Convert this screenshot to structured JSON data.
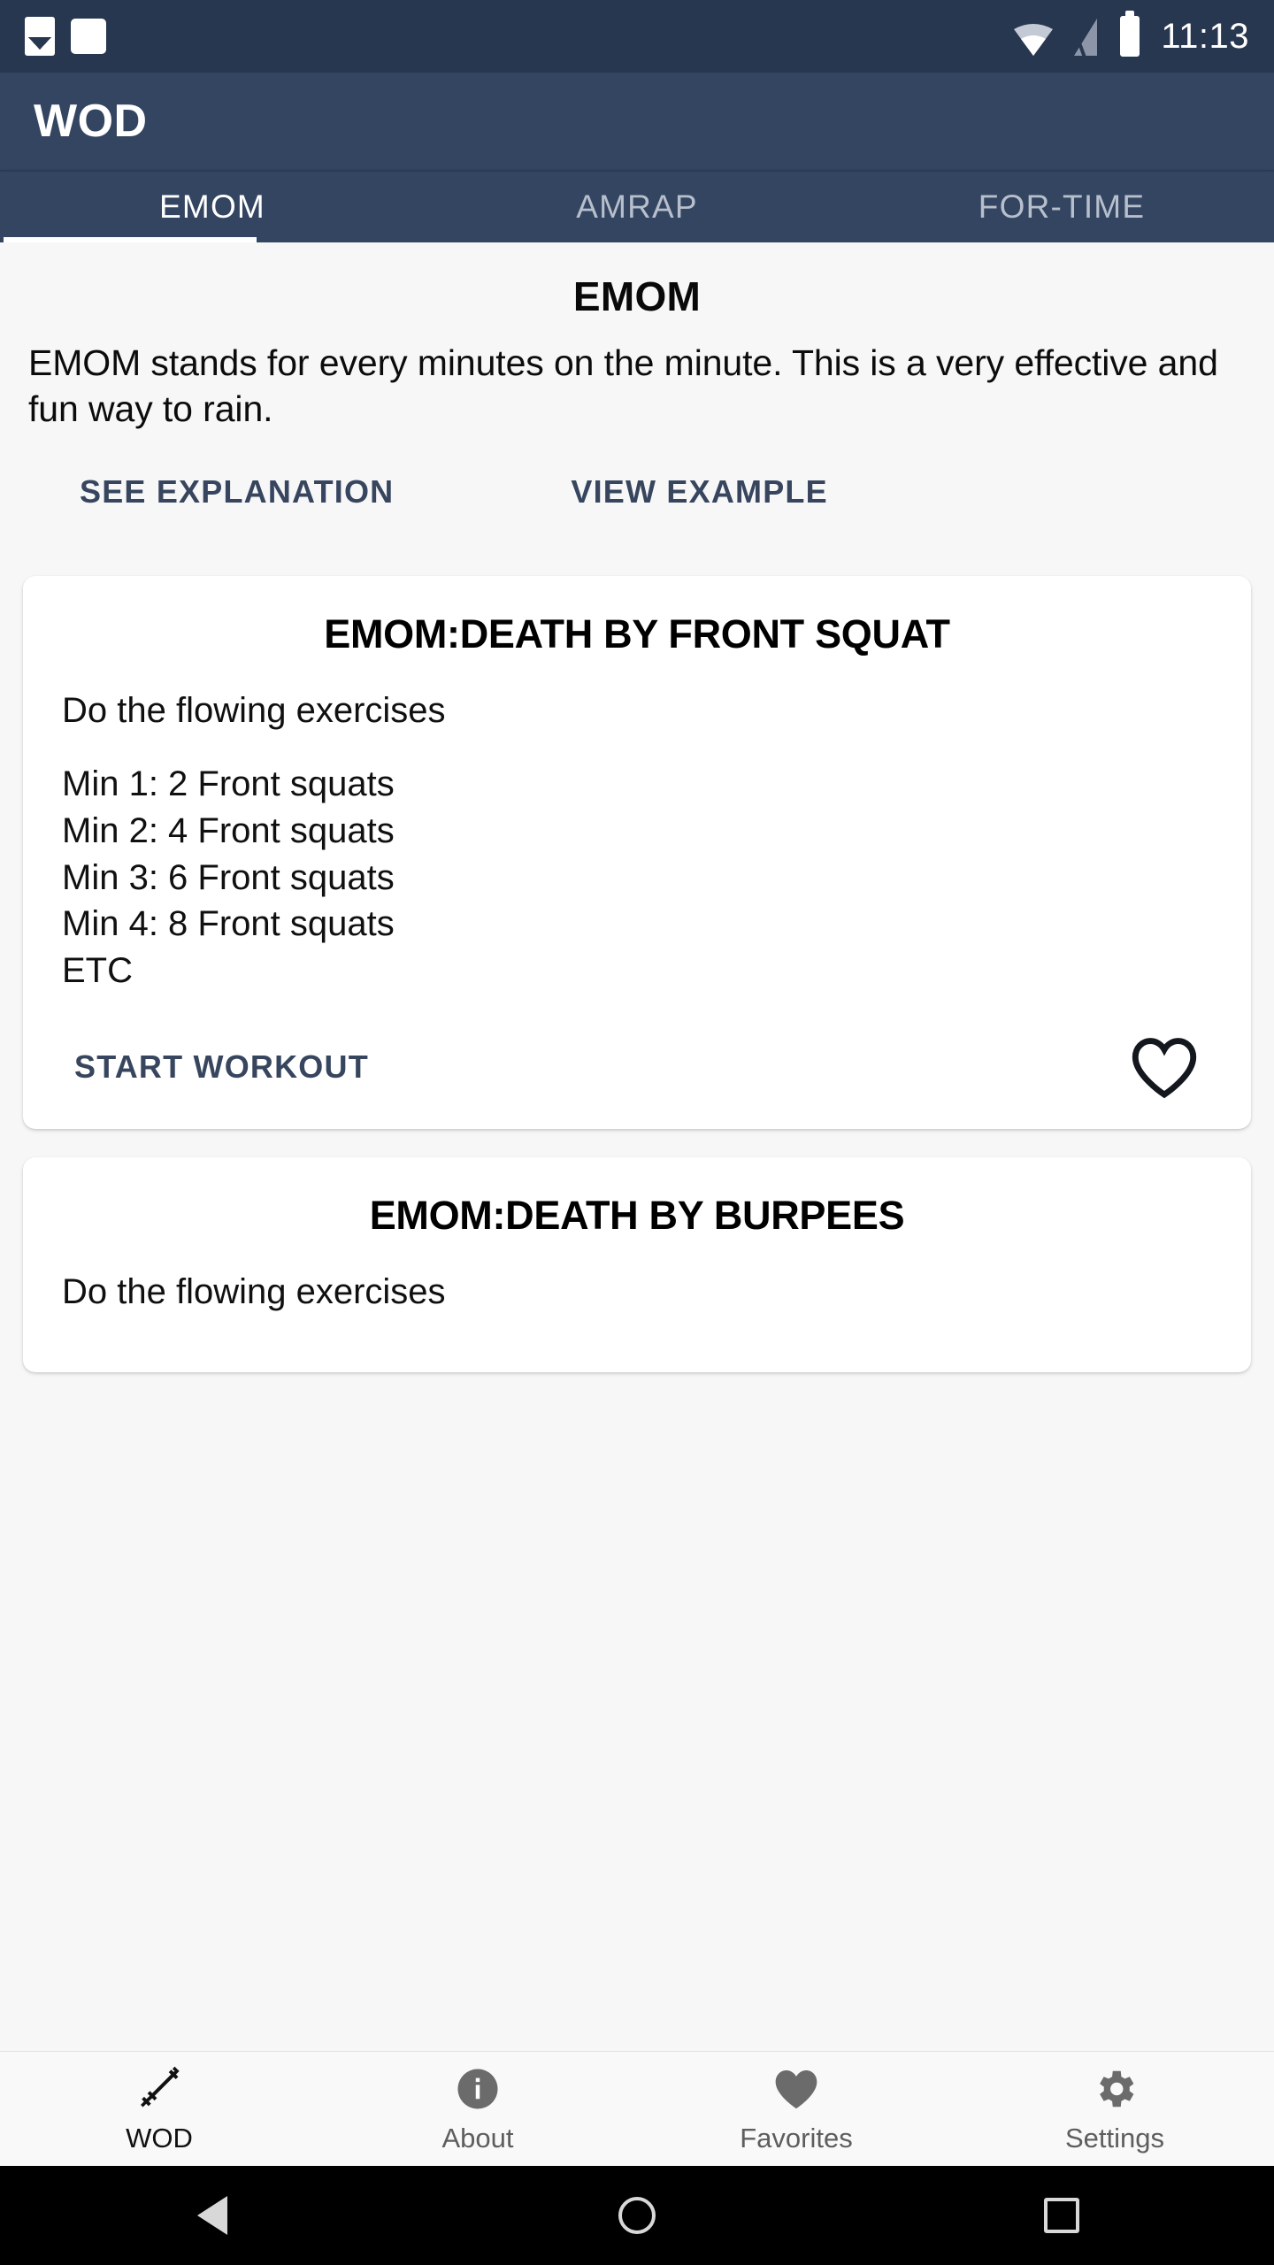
{
  "status_bar": {
    "time": "11:13",
    "icons": [
      "image-icon",
      "white-square-icon",
      "wifi-icon",
      "signal-off-icon",
      "battery-icon"
    ]
  },
  "app_bar": {
    "title": "WOD"
  },
  "tabs": [
    {
      "label": "EMOM",
      "active": true
    },
    {
      "label": "AMRAP",
      "active": false
    },
    {
      "label": "FOR-TIME",
      "active": false
    }
  ],
  "intro": {
    "title": "EMOM",
    "text": "EMOM stands for every minutes on the minute. This is a very effective and fun way to rain.",
    "see_explanation_label": "SEE EXPLANATION",
    "view_example_label": "VIEW EXAMPLE"
  },
  "cards": [
    {
      "title": "EMOM:DEATH BY FRONT SQUAT",
      "lead": "Do the flowing exercises",
      "lines": "Min 1: 2 Front squats\nMin 2: 4 Front squats\nMin 3: 6 Front squats\nMin 4: 8 Front squats\nETC",
      "start_label": "START WORKOUT",
      "favorite_icon": "heart-outline-icon"
    },
    {
      "title": "EMOM:DEATH BY BURPEES",
      "lead": "Do the flowing exercises"
    }
  ],
  "bottom_nav": [
    {
      "label": "WOD",
      "icon": "dumbbell-icon",
      "active": true
    },
    {
      "label": "About",
      "icon": "info-circle-icon",
      "active": false
    },
    {
      "label": "Favorites",
      "icon": "heart-filled-icon",
      "active": false
    },
    {
      "label": "Settings",
      "icon": "gear-icon",
      "active": false
    }
  ],
  "android_nav": [
    {
      "name": "back-button",
      "icon": "triangle-left-icon"
    },
    {
      "name": "home-button",
      "icon": "circle-icon"
    },
    {
      "name": "recents-button",
      "icon": "square-icon"
    }
  ],
  "colors": {
    "status_bar_bg": "#283750",
    "app_bar_bg": "#344561",
    "accent_link": "#37465e",
    "content_bg": "#f7f7f8",
    "card_bg": "#ffffff",
    "nav_bg": "#f9f9f9"
  }
}
